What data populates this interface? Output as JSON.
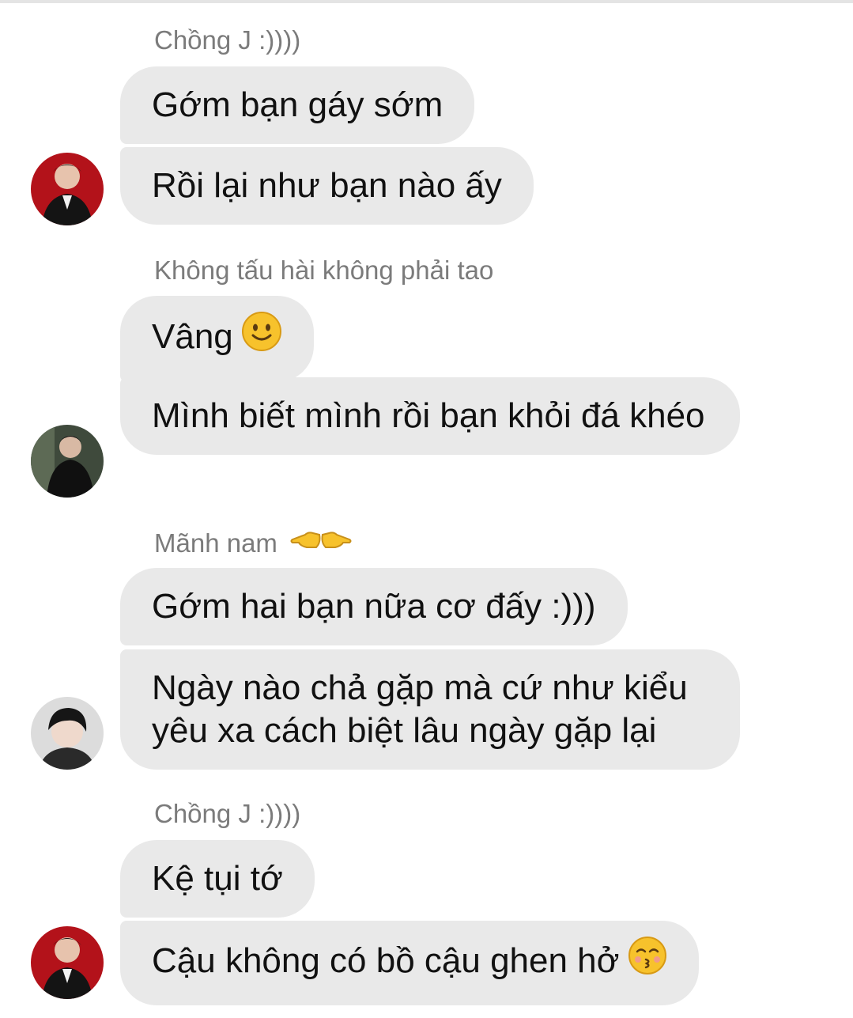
{
  "groups": [
    {
      "sender": "Chồng J :))))",
      "avatar_icon": "avatar-red-suit-icon",
      "messages": [
        "Gớm bạn gáy sớm",
        "Rồi lại như bạn nào ấy"
      ]
    },
    {
      "sender": "Không tấu hài không phải tao",
      "avatar_icon": "avatar-dark-suit-icon",
      "messages": [
        "Vâng",
        "Mình biết mình rồi bạn khỏi đá khéo"
      ],
      "emoji": "slightly-smiling-face-icon"
    },
    {
      "sender": "Mãnh nam",
      "sender_emoji": "pointing-hands-icon",
      "avatar_icon": "avatar-dark-hair-icon",
      "messages": [
        "Gớm hai bạn nữa cơ đấy :)))",
        "Ngày nào chả gặp mà cứ như kiểu yêu xa cách biệt lâu ngày gặp lại"
      ]
    },
    {
      "sender": "Chồng J :))))",
      "avatar_icon": "avatar-red-suit-icon",
      "messages": [
        "Kệ tụi tớ",
        "Cậu không có bồ cậu ghen hở"
      ],
      "emoji": "kissing-face-icon"
    }
  ],
  "colors": {
    "bubble": "#e9e9e9",
    "sender_text": "#7b7b7b",
    "message_text": "#111111",
    "avatar_red": "#b3121a",
    "emoji_yellow": "#f7c22c"
  }
}
